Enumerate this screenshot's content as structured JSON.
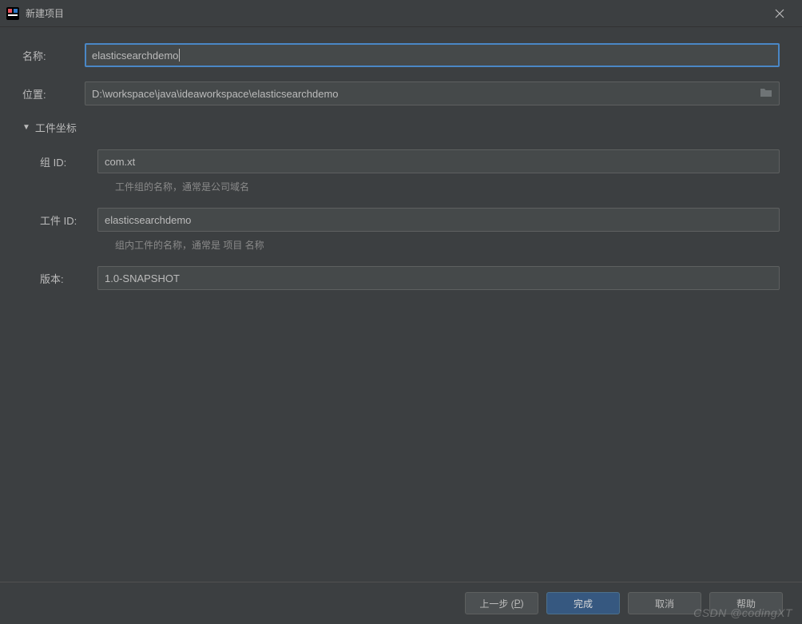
{
  "titlebar": {
    "title": "新建项目"
  },
  "labels": {
    "name": "名称:",
    "location": "位置:",
    "coords_section": "工件坐标",
    "group_id": "组 ID:",
    "artifact_id": "工件 ID:",
    "version": "版本:"
  },
  "fields": {
    "name": "elasticsearchdemo",
    "location": "D:\\workspace\\java\\ideaworkspace\\elasticsearchdemo",
    "group_id": "com.xt",
    "artifact_id": "elasticsearchdemo",
    "version": "1.0-SNAPSHOT"
  },
  "hints": {
    "group": "工件组的名称，通常是公司域名",
    "artifact": "组内工件的名称，通常是 项目 名称"
  },
  "buttons": {
    "prev_pre": "上一步 (",
    "prev_key": "P",
    "prev_post": ")",
    "finish": "完成",
    "cancel": "取消",
    "help": "帮助"
  },
  "watermark": "CSDN @codingXT"
}
